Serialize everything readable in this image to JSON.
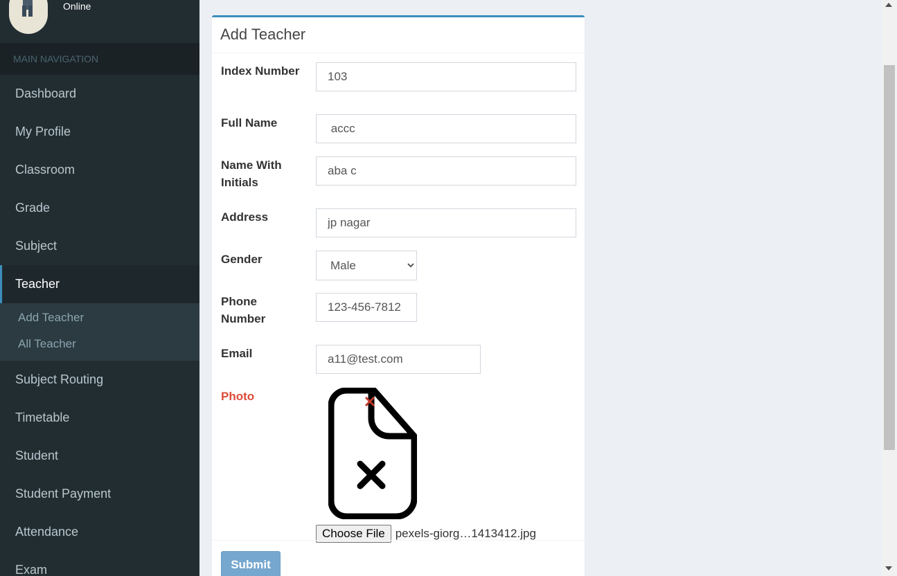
{
  "user": {
    "status": "Online"
  },
  "sidebar": {
    "header": "MAIN NAVIGATION",
    "items": [
      {
        "label": "Dashboard"
      },
      {
        "label": "My Profile"
      },
      {
        "label": "Classroom"
      },
      {
        "label": "Grade"
      },
      {
        "label": "Subject"
      },
      {
        "label": "Teacher"
      },
      {
        "label": "Subject Routing"
      },
      {
        "label": "Timetable"
      },
      {
        "label": "Student"
      },
      {
        "label": "Student Payment"
      },
      {
        "label": "Attendance"
      },
      {
        "label": "Exam"
      }
    ],
    "teacher_submenu": [
      {
        "label": "Add Teacher"
      },
      {
        "label": "All Teacher"
      }
    ]
  },
  "form": {
    "title": "Add Teacher",
    "index_number": {
      "label": "Index Number",
      "value": "103"
    },
    "full_name": {
      "label": "Full Name",
      "value": " accc"
    },
    "name_with_initials": {
      "label": "Name With Initials",
      "value": "aba c"
    },
    "address": {
      "label": "Address",
      "value": "jp nagar"
    },
    "gender": {
      "label": "Gender",
      "value": "Male"
    },
    "phone": {
      "label": "Phone Number",
      "value": "123-456-7812"
    },
    "email": {
      "label": "Email",
      "value": "a11@test.com"
    },
    "photo": {
      "label": "Photo",
      "choose_label": "Choose File",
      "file_name": "pexels-giorg…1413412.jpg"
    },
    "submit_label": "Submit"
  },
  "colors": {
    "sidebar_bg": "#222d32",
    "accent": "#3c8dbc",
    "error": "#dd4b39",
    "submit_bg": "#76a7cf"
  }
}
